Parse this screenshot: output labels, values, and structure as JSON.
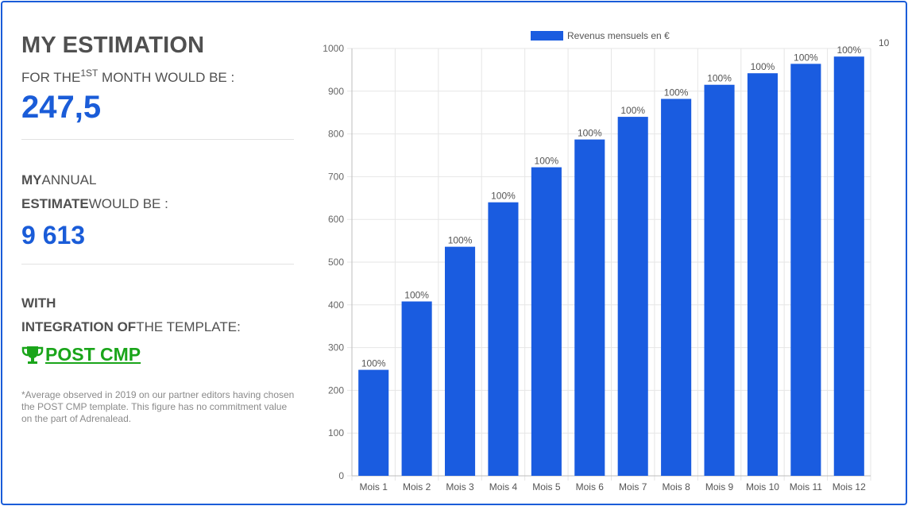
{
  "left": {
    "title": "MY ESTIMATION",
    "first_month": {
      "prefix": "FOR THE",
      "ordinal": "1ST",
      "suffix": " MONTH WOULD BE :",
      "value": "247,5"
    },
    "annual": {
      "bold1": "MY",
      "text1": "ANNUAL",
      "bold2": "ESTIMATE",
      "text2": "WOULD BE :",
      "value": "9 613"
    },
    "integration": {
      "bold1": "WITH",
      "bold2": "INTEGRATION OF",
      "text2": "THE TEMPLATE:",
      "link_label": " POST CMP",
      "trophy_icon": "trophy-icon"
    },
    "note": "*Average observed in 2019 on our partner editors having chosen the POST CMP template. This figure has no commitment value on the part of Adrenalead."
  },
  "colors": {
    "accent": "#1a5cd8",
    "cta": "#1aa51a",
    "bar": "#1a5ce0"
  },
  "chart_data": {
    "type": "bar",
    "categories": [
      "Mois 1",
      "Mois 2",
      "Mois 3",
      "Mois 4",
      "Mois 5",
      "Mois 6",
      "Mois 7",
      "Mois 8",
      "Mois 9",
      "Mois 10",
      "Mois 11",
      "Mois 12"
    ],
    "series": [
      {
        "name": "Revenus mensuels en €",
        "values": [
          248,
          408,
          536,
          640,
          722,
          787,
          840,
          882,
          915,
          942,
          964,
          981
        ],
        "data_labels": [
          "100%",
          "100%",
          "100%",
          "100%",
          "100%",
          "100%",
          "100%",
          "100%",
          "100%",
          "100%",
          "100%",
          "100%"
        ]
      }
    ],
    "ylim": [
      0,
      1000
    ],
    "yticks": [
      0,
      100,
      200,
      300,
      400,
      500,
      600,
      700,
      800,
      900,
      1000
    ],
    "right_label": "10",
    "grid": true,
    "legend": "top"
  }
}
